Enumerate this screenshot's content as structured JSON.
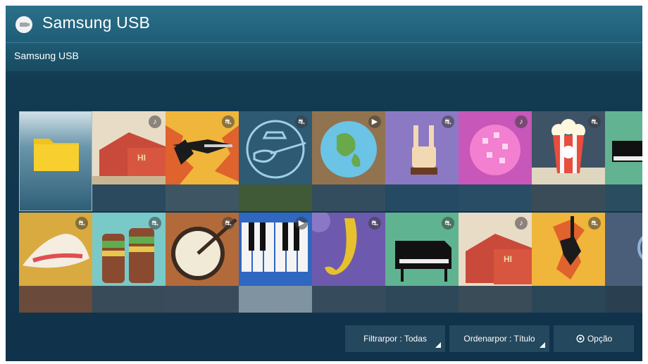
{
  "app": {
    "title": "Samsung USB",
    "icon": "usb-drive-icon"
  },
  "breadcrumb": {
    "label": "Samsung USB"
  },
  "grid": {
    "row1": [
      {
        "name": "folder-tile",
        "kind": "folder"
      },
      {
        "name": "music-thumbnail-barn",
        "badge": "♪"
      },
      {
        "name": "music-thumbnail-electric-guitar",
        "badge": "⛐"
      },
      {
        "name": "music-thumbnail-guitarist",
        "badge": "⛐"
      },
      {
        "name": "video-thumbnail-globe",
        "badge": "▶"
      },
      {
        "name": "music-thumbnail-rock-hand",
        "badge": "⛐"
      },
      {
        "name": "music-thumbnail-disco-ball",
        "badge": "♪"
      },
      {
        "name": "music-thumbnail-popcorn",
        "badge": "⛐"
      },
      {
        "name": "music-thumbnail-piano",
        "badge": ""
      }
    ],
    "row2": [
      {
        "name": "music-thumbnail-hat",
        "badge": "⛐"
      },
      {
        "name": "music-thumbnail-drums",
        "badge": "⛐"
      },
      {
        "name": "music-thumbnail-banjo",
        "badge": "⛐"
      },
      {
        "name": "video-thumbnail-keyboard",
        "badge": "▶"
      },
      {
        "name": "music-thumbnail-saxophone",
        "badge": "⛐"
      },
      {
        "name": "music-thumbnail-grand-piano",
        "badge": "⛐"
      },
      {
        "name": "music-thumbnail-barn-2",
        "badge": "♪"
      },
      {
        "name": "music-thumbnail-electric-guitar-2",
        "badge": "⛐"
      },
      {
        "name": "music-thumbnail-dark",
        "badge": ""
      }
    ]
  },
  "toolbar": {
    "filter_label": "Filtrarpor : Todas",
    "sort_label": "Ordenarpor : Título",
    "option_label": "Opção"
  },
  "colors": {
    "accent": "#1f5d78",
    "background": "#10324a"
  }
}
